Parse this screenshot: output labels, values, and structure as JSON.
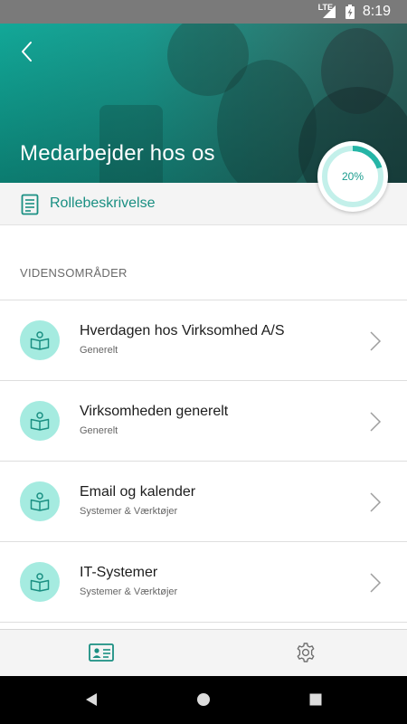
{
  "status_bar": {
    "network": "LTE",
    "time": "8:19"
  },
  "header": {
    "title": "Medarbejder hos os",
    "back_icon": "chevron-left-icon",
    "accent_color": "#1aa898"
  },
  "progress": {
    "label": "20%",
    "value": 0.2,
    "color": "#25b5a6",
    "track_color": "#c3f0ea"
  },
  "role": {
    "label": "Rollebeskrivelse",
    "icon": "document-icon"
  },
  "section": {
    "header": "VIDENSOMRÅDER"
  },
  "items": [
    {
      "title": "Hverdagen hos Virksomhed A/S",
      "subtitle": "Generelt",
      "icon": "book-person-icon"
    },
    {
      "title": "Virksomheden generelt",
      "subtitle": "Generelt",
      "icon": "book-person-icon"
    },
    {
      "title": "Email og kalender",
      "subtitle": "Systemer & Værktøjer",
      "icon": "book-person-icon"
    },
    {
      "title": "IT-Systemer",
      "subtitle": "Systemer & Værktøjer",
      "icon": "book-person-icon"
    }
  ],
  "bottom_nav": [
    {
      "icon": "id-card-icon",
      "active": true
    },
    {
      "icon": "gear-icon",
      "active": false
    }
  ],
  "system_nav": [
    "back-triangle-icon",
    "home-circle-icon",
    "recents-square-icon"
  ]
}
